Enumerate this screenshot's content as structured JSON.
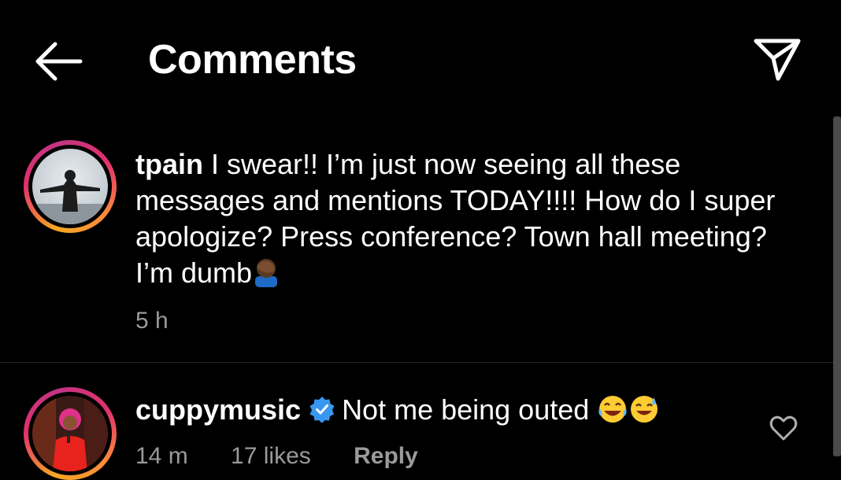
{
  "header": {
    "title": "Comments",
    "back_icon": "arrow-left-icon",
    "share_icon": "paper-plane-icon"
  },
  "comments": [
    {
      "username": "tpain",
      "text": "I swear!! I’m just now seeing all these messages and mentions TODAY!!!! How do I super apologize? Press conference? Town hall meeting? I’m dumb",
      "emoji": "facepalm-emoji",
      "time": "5 h",
      "verified": false
    },
    {
      "username": "cuppymusic",
      "text": "Not me being outed",
      "emoji": "laughing-emoji, sweat-smile-emoji",
      "time": "14 m",
      "likes": "17 likes",
      "reply_label": "Reply",
      "verified": true
    }
  ],
  "colors": {
    "background": "#000000",
    "text": "#ffffff",
    "meta_text": "#9a9a9a",
    "verified_blue": "#3897f0",
    "story_ring": "#e1306c"
  }
}
